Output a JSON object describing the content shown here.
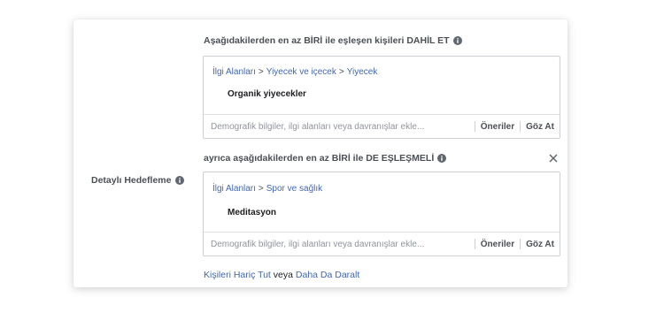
{
  "detailed_targeting": {
    "label": "Detaylı Hedefleme",
    "include_heading": "Aşağıdakilerden en az BİRİ ile eşleşen kişileri DAHİL ET",
    "include_group": {
      "breadcrumb": [
        "İlgi Alanları",
        "Yiyecek ve içecek",
        "Yiyecek"
      ],
      "item": "Organik yiyecekler",
      "placeholder": "Demografik bilgiler, ilgi alanları veya davranışlar ekle...",
      "suggestions_label": "Öneriler",
      "browse_label": "Göz At"
    },
    "narrow_heading": "ayrıca aşağıdakilerden en az BİRİ ile DE EŞLEŞMELİ",
    "narrow_group": {
      "breadcrumb": [
        "İlgi Alanları",
        "Spor ve sağlık"
      ],
      "item": "Meditasyon",
      "placeholder": "Demografik bilgiler, ilgi alanları veya davranışlar ekle...",
      "suggestions_label": "Öneriler",
      "browse_label": "Göz At"
    },
    "footer": {
      "exclude_link": "Kişileri Hariç Tut",
      "connector": "veya",
      "narrow_link": "Daha Da Daralt"
    }
  },
  "icons": [
    "info-icon",
    "close-icon"
  ],
  "colors": {
    "link": "#4267b2",
    "text": "#4b4f56",
    "border": "#ccd0d5"
  }
}
